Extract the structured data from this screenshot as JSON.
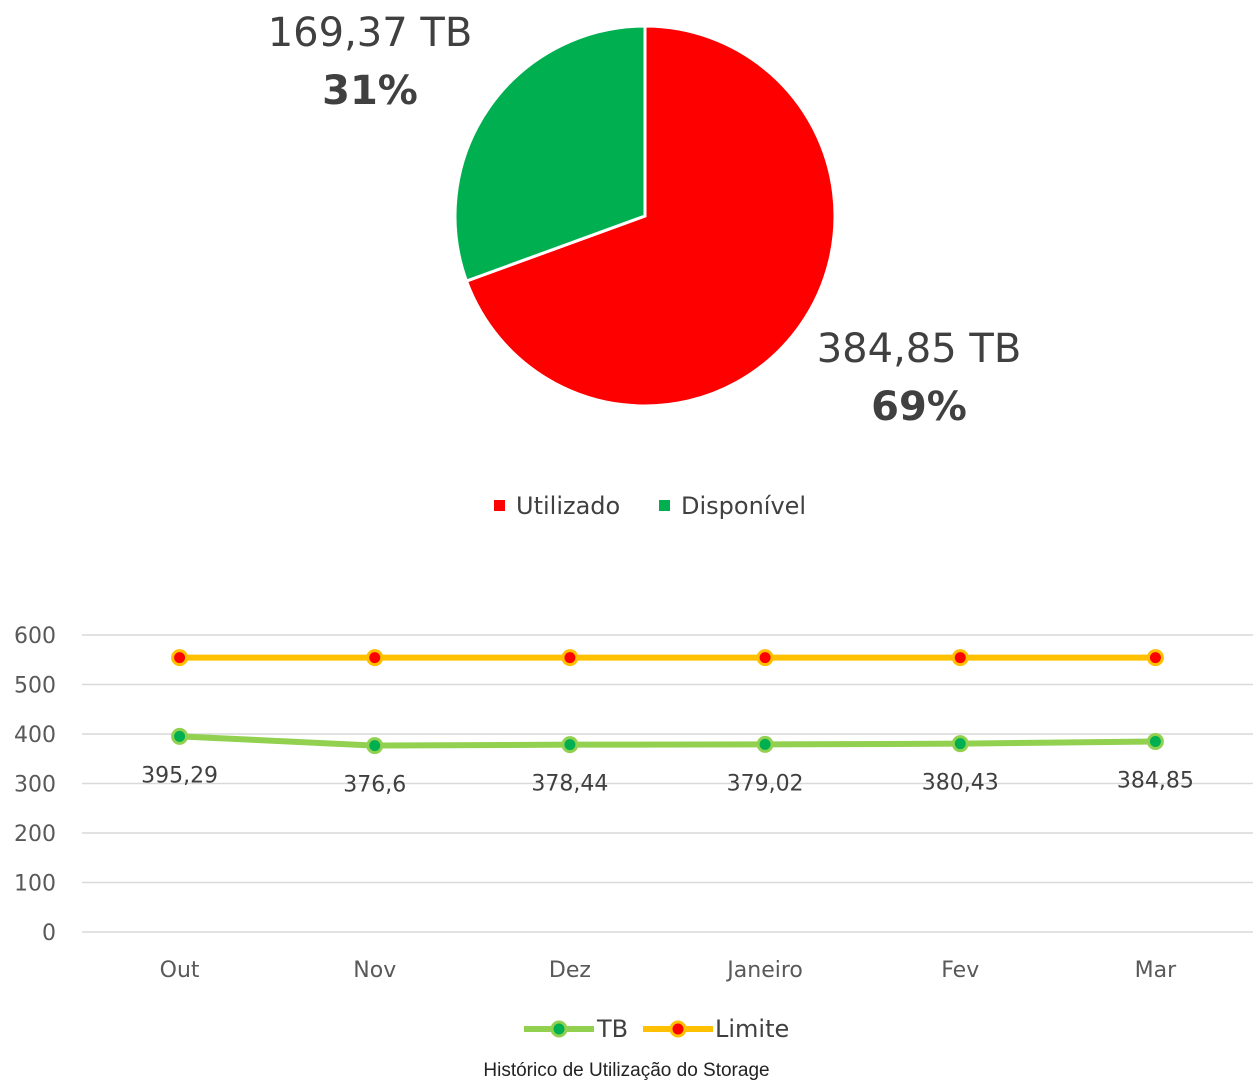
{
  "chart_data": [
    {
      "type": "pie",
      "slices": [
        {
          "name": "Utilizado",
          "value": 384.85,
          "value_label": "384,85 TB",
          "pct_label": "69%",
          "color": "#FF0000"
        },
        {
          "name": "Disponível",
          "value": 169.37,
          "value_label": "169,37 TB",
          "pct_label": "31%",
          "color": "#00B050"
        }
      ],
      "legend_position": "bottom",
      "title": ""
    },
    {
      "type": "line",
      "categories": [
        "Out",
        "Nov",
        "Dez",
        "Janeiro",
        "Fev",
        "Mar"
      ],
      "series": [
        {
          "name": "TB",
          "values": [
            395.29,
            376.6,
            378.44,
            379.02,
            380.43,
            384.85
          ],
          "labels": [
            "395,29",
            "376,6",
            "378,44",
            "379,02",
            "380,43",
            "384,85"
          ],
          "color": "#92D050",
          "marker_color": "#00B050"
        },
        {
          "name": "Limite",
          "values": [
            554.22,
            554.22,
            554.22,
            554.22,
            554.22,
            554.22
          ],
          "color": "#FFC000",
          "marker_color": "#FF0000"
        }
      ],
      "ylim": [
        0,
        600
      ],
      "yticks": [
        0,
        100,
        200,
        300,
        400,
        500,
        600
      ],
      "grid": true,
      "legend_position": "bottom",
      "xlabel": "",
      "ylabel": ""
    }
  ],
  "caption": "Histórico de Utilização do Storage"
}
